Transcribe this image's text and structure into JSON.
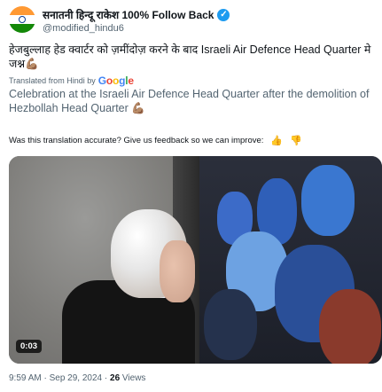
{
  "author": {
    "display_name": "सनातनी हिन्दू राकेश 100% Follow Back",
    "handle": "@modified_hindu6",
    "verified_badge": "✓",
    "avatar_colors": [
      "#ff9933",
      "#ffffff",
      "#138808"
    ]
  },
  "tweet": {
    "text": "हेजबुल्लाह हेड क्वार्टर को ज़मींदोज़ करने के बाद Israeli Air Defence Head Quarter मे जश्न💪🏽",
    "translated_label": "Translated from Hindi by",
    "translator_brand": "Google",
    "translation": "Celebration at the Israeli Air Defence Head Quarter after the demolition of Hezbollah Head Quarter 💪🏽",
    "feedback_prompt": "Was this translation accurate? Give us feedback so we can improve:",
    "thumbs_up_icon": "👍",
    "thumbs_down_icon": "👎"
  },
  "media": {
    "duration": "0:03"
  },
  "meta": {
    "time": "9:59 AM",
    "separator": "·",
    "date": "Sep 29, 2024",
    "views_count": "26",
    "views_label": "Views"
  },
  "google_colors": [
    "#4285f4",
    "#ea4335",
    "#fbbc05",
    "#4285f4",
    "#34a853",
    "#ea4335"
  ]
}
